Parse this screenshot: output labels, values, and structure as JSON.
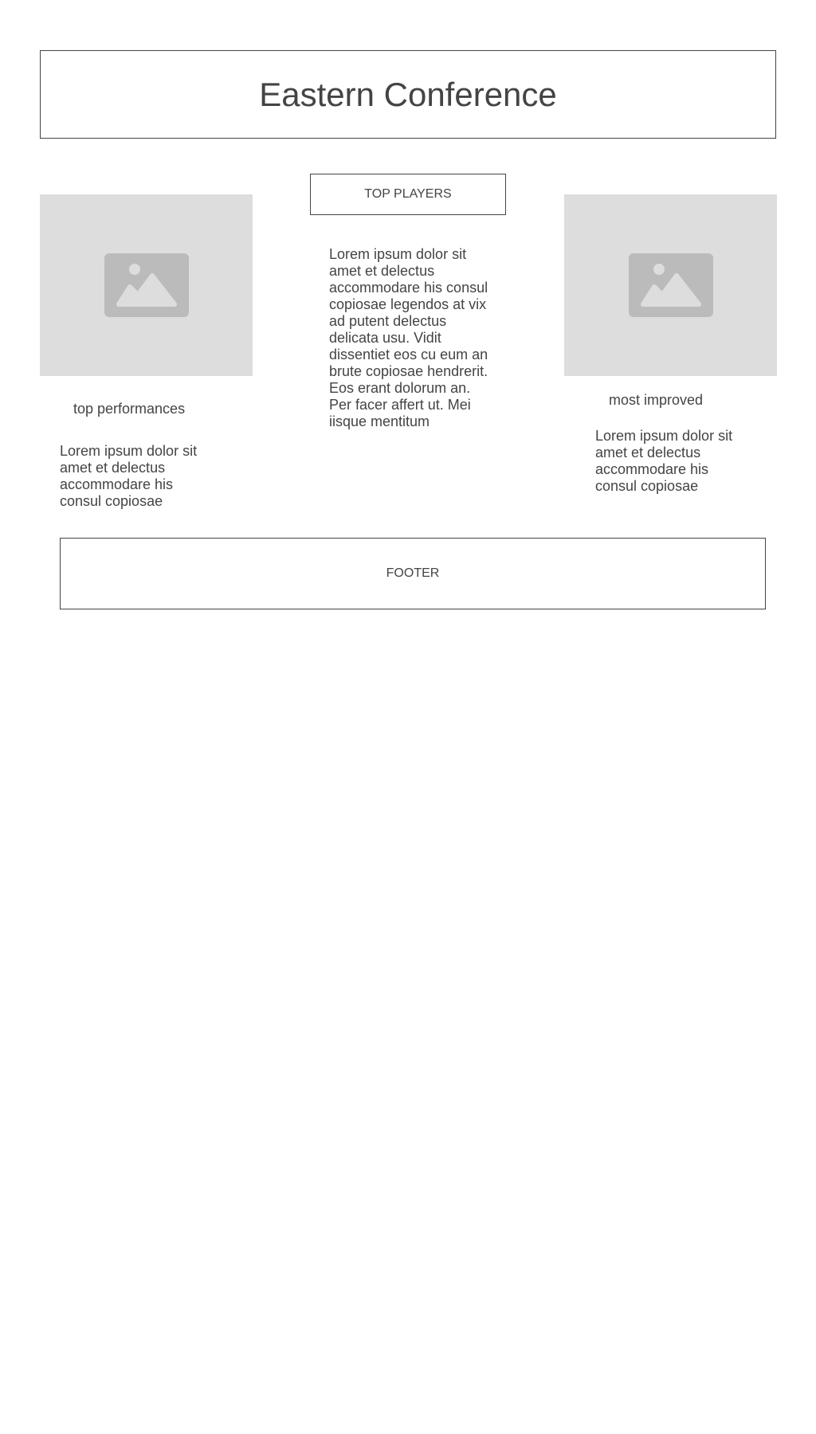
{
  "header": {
    "title": "Eastern Conference"
  },
  "center": {
    "button_label": "TOP PLAYERS",
    "text": "Lorem ipsum dolor sit amet et delectus accommodare his consul copiosae legendos at vix ad putent delectus delicata usu. Vidit dissentiet eos cu eum an brute copiosae hendrerit. Eos erant dolorum an. Per facer affert ut. Mei iisque mentitum"
  },
  "left_column": {
    "image_icon": "image-icon",
    "caption": "top performances",
    "text": "Lorem ipsum dolor sit amet et delectus accommodare his consul copiosae"
  },
  "right_column": {
    "image_icon": "image-icon",
    "caption": "most improved",
    "text": "Lorem ipsum dolor sit amet et delectus accommodare his consul copiosae"
  },
  "footer": {
    "label": "FOOTER"
  },
  "colors": {
    "text": "#444444",
    "border": "#444444",
    "placeholder_bg": "#dddddd",
    "placeholder_icon": "#bbbbbb"
  }
}
